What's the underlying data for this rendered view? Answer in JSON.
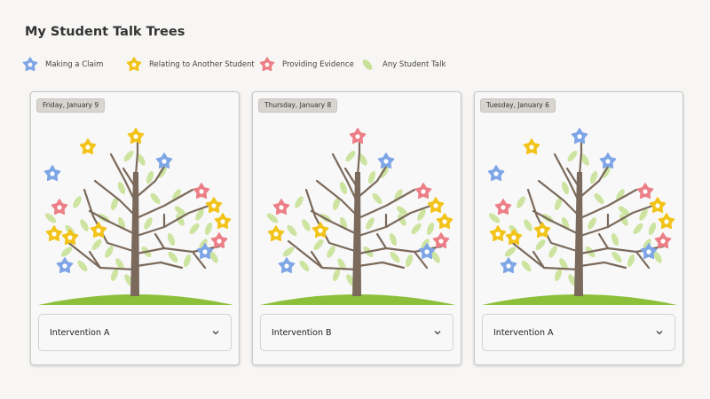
{
  "page": {
    "title": "My Student Talk Trees"
  },
  "legend": [
    {
      "label": "Making a Claim",
      "icon": "blue-star-flower-icon",
      "color": "#7ea6e6"
    },
    {
      "label": "Relating to Another Student",
      "icon": "yellow-star-flower-icon",
      "color": "#f2c318"
    },
    {
      "label": "Providing Evidence",
      "icon": "pink-star-flower-icon",
      "color": "#ec7e86"
    },
    {
      "label": "Any Student Talk",
      "icon": "green-leaf-icon",
      "color": "#c8e09a"
    }
  ],
  "colors": {
    "trunk": "#7b6a5c",
    "grass": "#8cbf3a",
    "leaf": "#cde4a1"
  },
  "cards": [
    {
      "date": "Friday, January 9",
      "intervention": "Intervention A"
    },
    {
      "date": "Thursday, January 8",
      "intervention": "Intervention B"
    },
    {
      "date": "Tuesday, January 6",
      "intervention": "Intervention A"
    }
  ]
}
